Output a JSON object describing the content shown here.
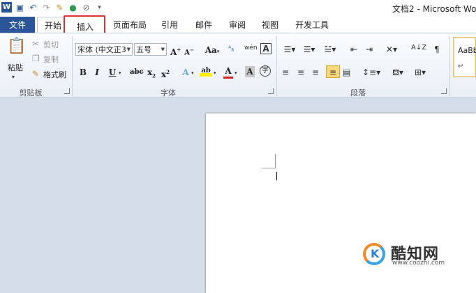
{
  "title_bar": {
    "document_title": "文档2 - Microsoft Wo",
    "quick_access": [
      {
        "icon": "word-app-icon",
        "glyph": "W"
      },
      {
        "icon": "save-icon",
        "glyph": "▣"
      },
      {
        "icon": "undo-icon",
        "glyph": "↶"
      },
      {
        "icon": "redo-icon",
        "glyph": "↷"
      },
      {
        "icon": "format-painter-icon",
        "glyph": "✎"
      },
      {
        "icon": "color-wheel-icon",
        "glyph": "●"
      },
      {
        "icon": "clear-format-icon",
        "glyph": "⊘"
      },
      {
        "icon": "customize-qat-icon",
        "glyph": "▾"
      }
    ]
  },
  "tabs": {
    "file": "文件",
    "home": "开始",
    "insert": "插入",
    "page_layout": "页面布局",
    "references": "引用",
    "mailings": "邮件",
    "review": "审阅",
    "view": "视图",
    "developer": "开发工具"
  },
  "highlight": {
    "target": "insert",
    "color": "#e0322c"
  },
  "clipboard": {
    "paste": "粘贴",
    "cut": "剪切",
    "copy": "复制",
    "format_painter": "格式刷",
    "group_label": "剪贴板"
  },
  "font": {
    "font_name": "宋体 (中文正3",
    "font_size": "五号",
    "group_label": "字体"
  },
  "paragraph": {
    "group_label": "段落"
  },
  "styles": {
    "preview": "AaBb"
  },
  "watermark": {
    "name": "酷知网",
    "url": "www.coozhi.com",
    "mark": "K"
  },
  "colors": {
    "file_tab": "#2a5699",
    "highlight": "#e0322c",
    "doc_background": "#d5dde8"
  }
}
